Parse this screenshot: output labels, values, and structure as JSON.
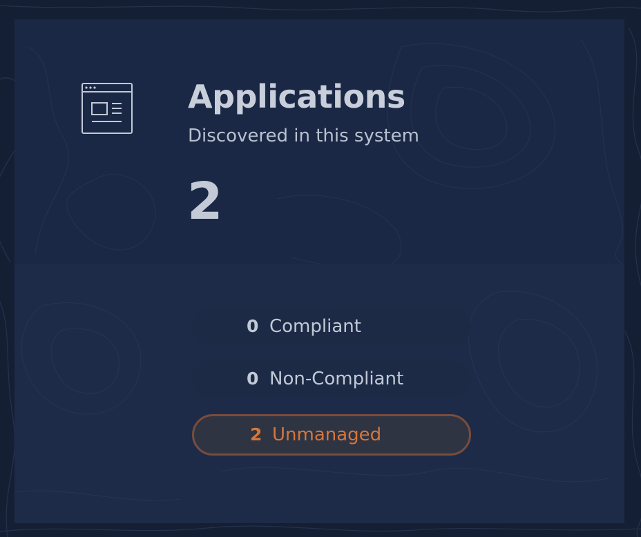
{
  "card": {
    "title": "Applications",
    "subtitle": "Discovered in this system",
    "count": "2"
  },
  "icons": {
    "app": "browser-window-icon"
  },
  "statuses": [
    {
      "count": "0",
      "label": "Compliant"
    },
    {
      "count": "0",
      "label": "Non-Compliant"
    },
    {
      "count": "2",
      "label": "Unmanaged"
    }
  ],
  "colors": {
    "background": "#151f33",
    "card": "#1b2845",
    "text": "#c8cfdb",
    "unmanaged_accent": "#d7763a"
  }
}
